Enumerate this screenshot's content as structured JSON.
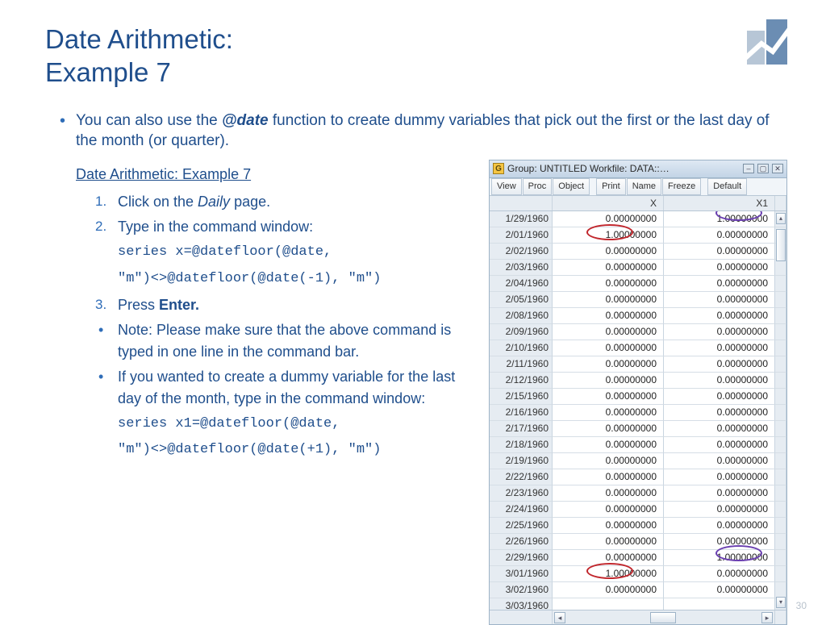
{
  "title_line1": "Date Arithmetic:",
  "title_line2": "Example 7",
  "intro_pre": "You can also use the ",
  "intro_fn": "@date",
  "intro_post": " function to create dummy variables that pick out the first or the last day of the month (or quarter).",
  "subhead": "Date Arithmetic: Example 7",
  "step1_pre": "Click on the ",
  "step1_it": "Daily",
  "step1_post": " page.",
  "step2": "Type in the command window:",
  "code1a": "series x=@datefloor(@date,",
  "code1b": "\"m\")<>@datefloor(@date(-1), \"m\")",
  "step3_pre": "Press ",
  "step3_b": "Enter.",
  "note1": "Note: Please make sure that the above command is typed in one line in the command bar.",
  "note2": "If you wanted to create a dummy variable for the last day of the month, type in the command window:",
  "code2a": "series x1=@datefloor(@date,",
  "code2b": "\"m\")<>@datefloor(@date(+1), \"m\")",
  "pagenum": "30",
  "ewin": {
    "title": "Group: UNTITLED   Workfile: DATA::…",
    "toolbar": [
      "View",
      "Proc",
      "Object",
      "Print",
      "Name",
      "Freeze",
      "Default"
    ],
    "cols": [
      "",
      "X",
      "X1"
    ],
    "rows": [
      {
        "d": "1/29/1960",
        "x": "0.00000000",
        "x1": "1.00000000"
      },
      {
        "d": "2/01/1960",
        "x": "1.00000000",
        "x1": "0.00000000"
      },
      {
        "d": "2/02/1960",
        "x": "0.00000000",
        "x1": "0.00000000"
      },
      {
        "d": "2/03/1960",
        "x": "0.00000000",
        "x1": "0.00000000"
      },
      {
        "d": "2/04/1960",
        "x": "0.00000000",
        "x1": "0.00000000"
      },
      {
        "d": "2/05/1960",
        "x": "0.00000000",
        "x1": "0.00000000"
      },
      {
        "d": "2/08/1960",
        "x": "0.00000000",
        "x1": "0.00000000"
      },
      {
        "d": "2/09/1960",
        "x": "0.00000000",
        "x1": "0.00000000"
      },
      {
        "d": "2/10/1960",
        "x": "0.00000000",
        "x1": "0.00000000"
      },
      {
        "d": "2/11/1960",
        "x": "0.00000000",
        "x1": "0.00000000"
      },
      {
        "d": "2/12/1960",
        "x": "0.00000000",
        "x1": "0.00000000"
      },
      {
        "d": "2/15/1960",
        "x": "0.00000000",
        "x1": "0.00000000"
      },
      {
        "d": "2/16/1960",
        "x": "0.00000000",
        "x1": "0.00000000"
      },
      {
        "d": "2/17/1960",
        "x": "0.00000000",
        "x1": "0.00000000"
      },
      {
        "d": "2/18/1960",
        "x": "0.00000000",
        "x1": "0.00000000"
      },
      {
        "d": "2/19/1960",
        "x": "0.00000000",
        "x1": "0.00000000"
      },
      {
        "d": "2/22/1960",
        "x": "0.00000000",
        "x1": "0.00000000"
      },
      {
        "d": "2/23/1960",
        "x": "0.00000000",
        "x1": "0.00000000"
      },
      {
        "d": "2/24/1960",
        "x": "0.00000000",
        "x1": "0.00000000"
      },
      {
        "d": "2/25/1960",
        "x": "0.00000000",
        "x1": "0.00000000"
      },
      {
        "d": "2/26/1960",
        "x": "0.00000000",
        "x1": "0.00000000"
      },
      {
        "d": "2/29/1960",
        "x": "0.00000000",
        "x1": "1.00000000"
      },
      {
        "d": "3/01/1960",
        "x": "1.00000000",
        "x1": "0.00000000"
      },
      {
        "d": "3/02/1960",
        "x": "0.00000000",
        "x1": "0.00000000"
      },
      {
        "d": "3/03/1960",
        "x": "",
        "x1": ""
      }
    ]
  }
}
